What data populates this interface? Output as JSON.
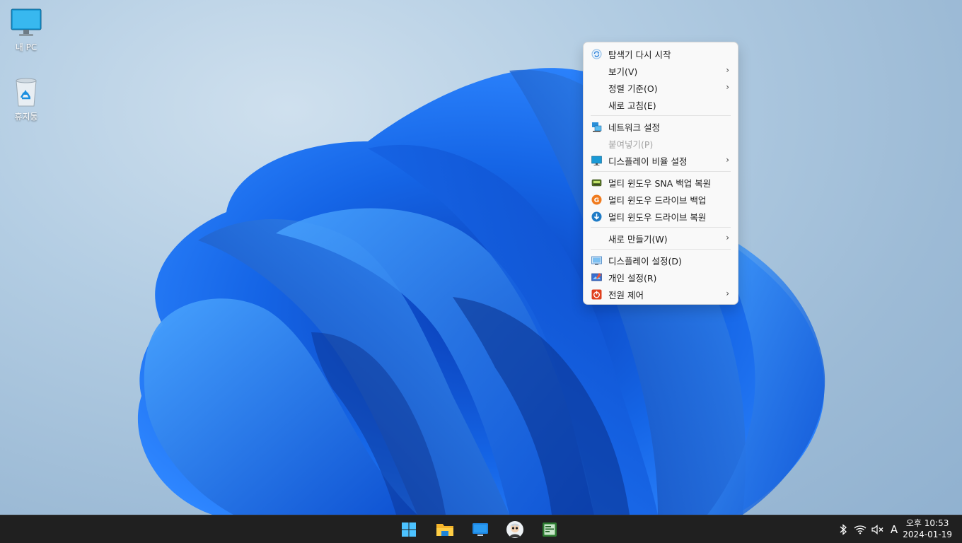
{
  "desktop": {
    "icons": [
      {
        "label": "내 PC",
        "icon": "monitor-icon"
      },
      {
        "label": "휴지통",
        "icon": "recycle-bin-icon"
      }
    ]
  },
  "context_menu": {
    "items": [
      {
        "label": "탐색기 다시 시작",
        "icon": "refresh-icon",
        "submenu": false
      },
      {
        "label": "보기(V)",
        "submenu": true
      },
      {
        "label": "정렬 기준(O)",
        "submenu": true
      },
      {
        "label": "새로 고침(E)",
        "submenu": false
      },
      {
        "label": "네트워크 설정",
        "icon": "network-icon",
        "submenu": false
      },
      {
        "label": "붙여넣기(P)",
        "disabled": true,
        "submenu": false
      },
      {
        "label": "디스플레이 비율 설정",
        "icon": "monitor-icon",
        "submenu": true
      },
      {
        "label": "멀티 윈도우 SNA 백업 복원",
        "icon": "drive-icon",
        "submenu": false
      },
      {
        "label": "멀티 윈도우 드라이브 백업",
        "icon": "backup-icon",
        "submenu": false
      },
      {
        "label": "멀티 윈도우 드라이브 복원",
        "icon": "restore-icon",
        "submenu": false
      },
      {
        "label": "새로 만들기(W)",
        "submenu": true
      },
      {
        "label": "디스플레이 설정(D)",
        "icon": "display-settings-icon",
        "submenu": false
      },
      {
        "label": "개인 설정(R)",
        "icon": "personalize-icon",
        "submenu": false
      },
      {
        "label": "전원 제어",
        "icon": "power-icon",
        "submenu": true
      }
    ],
    "arrow": "›"
  },
  "taskbar": {
    "apps": [
      "start-icon",
      "file-explorer-icon",
      "remote-desktop-icon",
      "user-avatar-icon",
      "terminal-icon"
    ],
    "tray": {
      "ime": "A"
    },
    "clock": {
      "time": "오후 10:53",
      "date": "2024-01-19"
    }
  },
  "colors": {
    "accent": "#1e6fe8",
    "menu_bg": "#f9f9f9",
    "taskbar_bg": "#202020"
  }
}
